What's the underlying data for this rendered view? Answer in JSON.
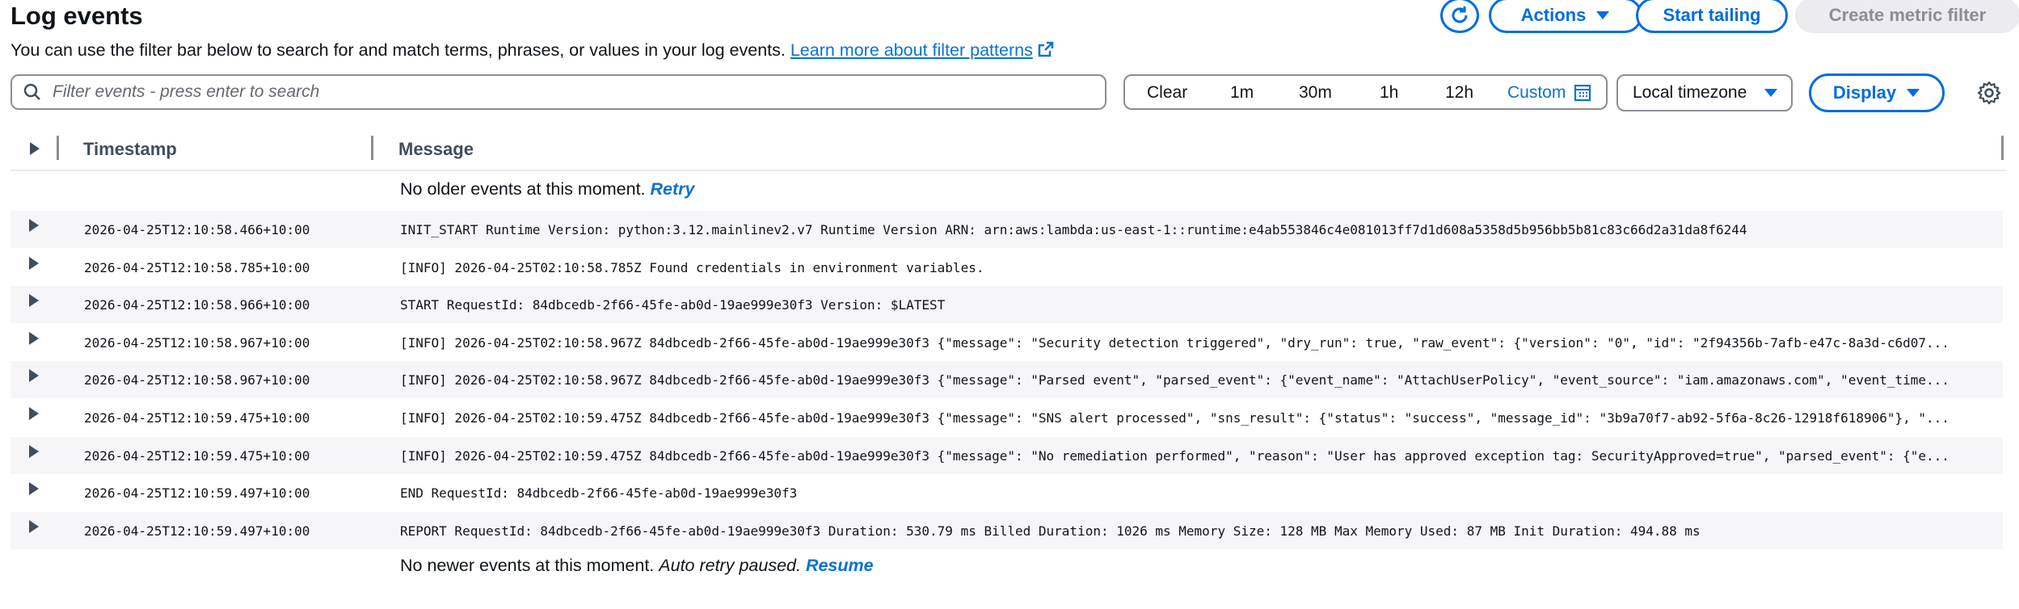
{
  "header": {
    "title": "Log events",
    "description": "You can use the filter bar below to search for and match terms, phrases, or values in your log events.",
    "learn_more": "Learn more about filter patterns",
    "actions_label": "Actions",
    "start_tailing_label": "Start tailing",
    "create_metric_filter_label": "Create metric filter"
  },
  "filter": {
    "placeholder": "Filter events - press enter to search",
    "value": ""
  },
  "time_range": {
    "options": [
      "Clear",
      "1m",
      "30m",
      "1h",
      "12h",
      "Custom"
    ],
    "selected": "Custom"
  },
  "timezone": {
    "selected": "Local timezone"
  },
  "display_label": "Display",
  "table": {
    "columns": [
      "Timestamp",
      "Message"
    ],
    "no_older": "No older events at this moment.",
    "retry": "Retry",
    "no_newer": "No newer events at this moment.",
    "auto_retry": "Auto retry paused.",
    "resume": "Resume",
    "rows": [
      {
        "timestamp": "2026-04-25T12:10:58.466+10:00",
        "message": "INIT_START Runtime Version: python:3.12.mainlinev2.v7 Runtime Version ARN: arn:aws:lambda:us-east-1::runtime:e4ab553846c4e081013ff7d1d608a5358d5b956bb5b81c83c66d2a31da8f6244"
      },
      {
        "timestamp": "2026-04-25T12:10:58.785+10:00",
        "message": "[INFO] 2026-04-25T02:10:58.785Z Found credentials in environment variables."
      },
      {
        "timestamp": "2026-04-25T12:10:58.966+10:00",
        "message": "START RequestId: 84dbcedb-2f66-45fe-ab0d-19ae999e30f3 Version: $LATEST"
      },
      {
        "timestamp": "2026-04-25T12:10:58.967+10:00",
        "message": "[INFO] 2026-04-25T02:10:58.967Z 84dbcedb-2f66-45fe-ab0d-19ae999e30f3 {\"message\": \"Security detection triggered\", \"dry_run\": true, \"raw_event\": {\"version\": \"0\", \"id\": \"2f94356b-7afb-e47c-8a3d-c6d07..."
      },
      {
        "timestamp": "2026-04-25T12:10:58.967+10:00",
        "message": "[INFO] 2026-04-25T02:10:58.967Z 84dbcedb-2f66-45fe-ab0d-19ae999e30f3 {\"message\": \"Parsed event\", \"parsed_event\": {\"event_name\": \"AttachUserPolicy\", \"event_source\": \"iam.amazonaws.com\", \"event_time..."
      },
      {
        "timestamp": "2026-04-25T12:10:59.475+10:00",
        "message": "[INFO] 2026-04-25T02:10:59.475Z 84dbcedb-2f66-45fe-ab0d-19ae999e30f3 {\"message\": \"SNS alert processed\", \"sns_result\": {\"status\": \"success\", \"message_id\": \"3b9a70f7-ab92-5f6a-8c26-12918f618906\"}, \"..."
      },
      {
        "timestamp": "2026-04-25T12:10:59.475+10:00",
        "message": "[INFO] 2026-04-25T02:10:59.475Z 84dbcedb-2f66-45fe-ab0d-19ae999e30f3 {\"message\": \"No remediation performed\", \"reason\": \"User has approved exception tag: SecurityApproved=true\", \"parsed_event\": {\"e..."
      },
      {
        "timestamp": "2026-04-25T12:10:59.497+10:00",
        "message": "END RequestId: 84dbcedb-2f66-45fe-ab0d-19ae999e30f3"
      },
      {
        "timestamp": "2026-04-25T12:10:59.497+10:00",
        "message": "REPORT RequestId: 84dbcedb-2f66-45fe-ab0d-19ae999e30f3 Duration: 530.79 ms Billed Duration: 1026 ms Memory Size: 128 MB Max Memory Used: 87 MB Init Duration: 494.88 ms"
      }
    ]
  },
  "colors": {
    "accent": "#006ce0",
    "link": "#0972d3",
    "row_alt": "#f6f6f9",
    "disabled": "#8c8c94"
  }
}
